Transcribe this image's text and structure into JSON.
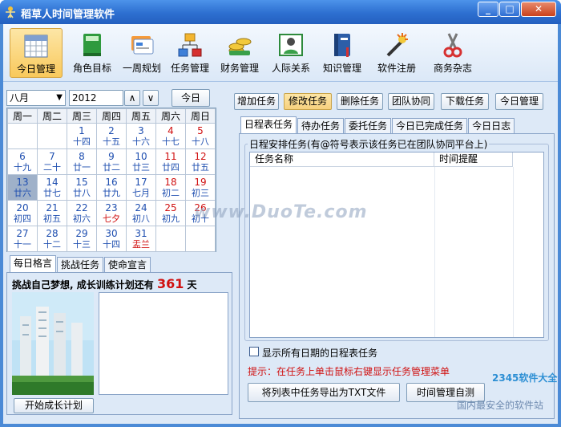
{
  "window": {
    "title": "稻草人时间管理软件",
    "min": "_",
    "max": "□",
    "close": "✕"
  },
  "toolbar": [
    {
      "label": "今日管理",
      "icon": "calendar-icon"
    },
    {
      "label": "角色目标",
      "icon": "book-icon"
    },
    {
      "label": "一周规划",
      "icon": "cards-icon"
    },
    {
      "label": "任务管理",
      "icon": "hierarchy-icon"
    },
    {
      "label": "财务管理",
      "icon": "coins-icon"
    },
    {
      "label": "人际关系",
      "icon": "contact-card-icon"
    },
    {
      "label": "知识管理",
      "icon": "knowledge-book-icon"
    },
    {
      "label": "软件注册",
      "icon": "magic-wand-icon"
    },
    {
      "label": "商务杂志",
      "icon": "scissors-icon"
    }
  ],
  "calendar": {
    "month": "八月",
    "year": "2012",
    "prev": "∧",
    "next": "∨",
    "today_btn": "今日",
    "weekdays": [
      "周一",
      "周二",
      "周三",
      "周四",
      "周五",
      "周六",
      "周日"
    ],
    "rows": [
      [
        {
          "d": "",
          "l": ""
        },
        {
          "d": "",
          "l": ""
        },
        {
          "d": "1",
          "l": "十四"
        },
        {
          "d": "2",
          "l": "十五"
        },
        {
          "d": "3",
          "l": "十六"
        },
        {
          "d": "4",
          "l": "十七"
        },
        {
          "d": "5",
          "l": "十八"
        }
      ],
      [
        {
          "d": "6",
          "l": "十九"
        },
        {
          "d": "7",
          "l": "二十"
        },
        {
          "d": "8",
          "l": "廿一"
        },
        {
          "d": "9",
          "l": "廿二"
        },
        {
          "d": "10",
          "l": "廿三"
        },
        {
          "d": "11",
          "l": "廿四"
        },
        {
          "d": "12",
          "l": "廿五"
        }
      ],
      [
        {
          "d": "13",
          "l": "廿六"
        },
        {
          "d": "14",
          "l": "廿七"
        },
        {
          "d": "15",
          "l": "廿八"
        },
        {
          "d": "16",
          "l": "廿九"
        },
        {
          "d": "17",
          "l": "七月"
        },
        {
          "d": "18",
          "l": "初二"
        },
        {
          "d": "19",
          "l": "初三"
        }
      ],
      [
        {
          "d": "20",
          "l": "初四"
        },
        {
          "d": "21",
          "l": "初五"
        },
        {
          "d": "22",
          "l": "初六"
        },
        {
          "d": "23",
          "l": "七夕"
        },
        {
          "d": "24",
          "l": "初八"
        },
        {
          "d": "25",
          "l": "初九"
        },
        {
          "d": "26",
          "l": "初十"
        }
      ],
      [
        {
          "d": "27",
          "l": "十一"
        },
        {
          "d": "28",
          "l": "十二"
        },
        {
          "d": "29",
          "l": "十三"
        },
        {
          "d": "30",
          "l": "十四"
        },
        {
          "d": "31",
          "l": "盂兰"
        },
        {
          "d": "",
          "l": ""
        },
        {
          "d": "",
          "l": ""
        }
      ]
    ]
  },
  "left_tabs": [
    "每日格言",
    "挑战任务",
    "使命宣言"
  ],
  "challenge": {
    "prefix": "挑战自己梦想, 成长训练计划还有",
    "days": "361",
    "suffix": "天"
  },
  "start_plan": "开始成长计划",
  "actions": [
    "增加任务",
    "修改任务",
    "删除任务",
    "团队协同",
    "下载任务",
    "今日管理"
  ],
  "right_tabs": [
    "日程表任务",
    "待办任务",
    "委托任务",
    "今日已完成任务",
    "今日日志"
  ],
  "group_title": "日程安排任务(有@符号表示该任务已在团队协同平台上)",
  "columns": [
    "任务名称",
    "时间提醒"
  ],
  "checkbox_label": "显示所有日期的日程表任务",
  "hint": "提示：在任务上单击鼠标右键显示任务管理菜单",
  "export_btn": "将列表中任务导出为TXT文件",
  "guide_btn": "时间管理自测",
  "watermark": "www.DuoTe.com",
  "corner_logo": "2345软件大全",
  "corner_text": "国内最安全的软件站",
  "colors": {
    "title_bg": "#2d6fd0",
    "client_bg": "#dde9f7",
    "accent_red": "#d01010",
    "link_blue": "#1f4fb0"
  }
}
